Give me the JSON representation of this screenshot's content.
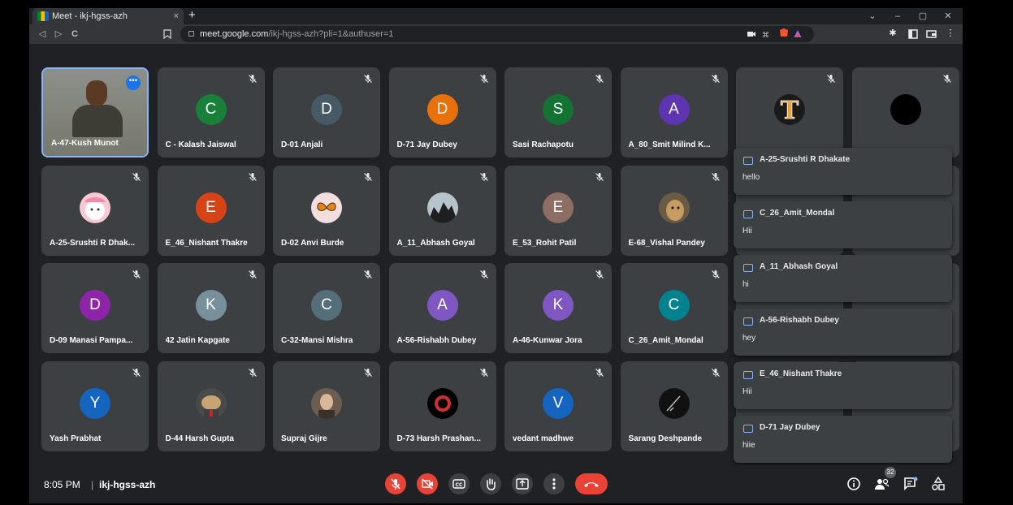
{
  "browser": {
    "tab_title": "Meet - ikj-hgss-azh",
    "tab_close": "×",
    "new_tab": "+",
    "url_host": "meet.google.com",
    "url_path": "/ikj-hgss-azh?pli=1&authuser=1",
    "window_controls": [
      "⌄",
      "–",
      "▢",
      "✕"
    ]
  },
  "nav": {
    "back": "◁",
    "forward": "▷",
    "reload": "C"
  },
  "tiles": [
    {
      "name": "A-47-Kush Munot",
      "kind": "self"
    },
    {
      "name": "C - Kalash Jaiswal",
      "initial": "C",
      "color": "#188038"
    },
    {
      "name": "D-01 Anjali",
      "initial": "D",
      "color": "#455a64"
    },
    {
      "name": "D-71 Jay Dubey",
      "initial": "D",
      "color": "#e8710a"
    },
    {
      "name": "Sasi Rachapotu",
      "initial": "S",
      "color": "#137333"
    },
    {
      "name": "A_80_Smit Milind K...",
      "initial": "A",
      "color": "#5e35b1"
    },
    {
      "name": "",
      "photo": "letter-t"
    },
    {
      "name": "",
      "photo": "black-circle"
    },
    {
      "name": "A-25-Srushti R Dhak...",
      "photo": "cartoon-pink"
    },
    {
      "name": "E_46_Nishant Thakre",
      "initial": "E",
      "color": "#d84315"
    },
    {
      "name": "D-02 Anvi Burde",
      "photo": "butterfly"
    },
    {
      "name": "A_11_Abhash Goyal",
      "photo": "dark-scene"
    },
    {
      "name": "E_53_Rohit Patil",
      "initial": "E",
      "color": "#8d6e63"
    },
    {
      "name": "E-68_Vishal Pandey",
      "photo": "dog"
    },
    {
      "name": "",
      "photo": "hidden"
    },
    {
      "name": "",
      "photo": "hidden"
    },
    {
      "name": "D-09 Manasi Pampa...",
      "initial": "D",
      "color": "#8e24aa"
    },
    {
      "name": "42 Jatin Kapgate",
      "initial": "K",
      "color": "#78909c"
    },
    {
      "name": "C-32-Mansi Mishra",
      "initial": "C",
      "color": "#546e7a"
    },
    {
      "name": "A-56-Rishabh Dubey",
      "initial": "A",
      "color": "#7e57c2"
    },
    {
      "name": "A-46-Kunwar Jora",
      "initial": "K",
      "color": "#7e57c2"
    },
    {
      "name": "C_26_Amit_Mondal",
      "initial": "C",
      "color": "#00838f"
    },
    {
      "name": "",
      "photo": "hidden"
    },
    {
      "name": "",
      "photo": "hidden"
    },
    {
      "name": "Yash Prabhat",
      "initial": "Y",
      "color": "#1565c0"
    },
    {
      "name": "D-44 Harsh Gupta",
      "photo": "dog2"
    },
    {
      "name": "Supraj Gijre",
      "photo": "person"
    },
    {
      "name": "D-73 Harsh Prashan...",
      "photo": "red-ring"
    },
    {
      "name": "vedant madhwe",
      "initial": "V",
      "color": "#1565c0"
    },
    {
      "name": "Sarang Deshpande",
      "photo": "dark-art"
    },
    {
      "name": "",
      "photo": "hidden"
    },
    {
      "name": "",
      "photo": "hidden"
    }
  ],
  "chat_messages": [
    {
      "sender": "A-25-Srushti R Dhakate",
      "text": "hello"
    },
    {
      "sender": "C_26_Amit_Mondal",
      "text": "Hii"
    },
    {
      "sender": "A_11_Abhash Goyal",
      "text": "hi"
    },
    {
      "sender": "A-56-Rishabh Dubey",
      "text": "hey"
    },
    {
      "sender": "E_46_Nishant Thakre",
      "text": "Hii"
    },
    {
      "sender": "D-71 Jay Dubey",
      "text": "hiie"
    }
  ],
  "bottom": {
    "time": "8:05 PM",
    "separator": "|",
    "meeting_code": "ikj-hgss-azh",
    "participant_count": "32"
  },
  "colors": {
    "background": "#202124",
    "tile": "#3c4043",
    "danger": "#ea4335",
    "accent": "#8ab4f8"
  }
}
